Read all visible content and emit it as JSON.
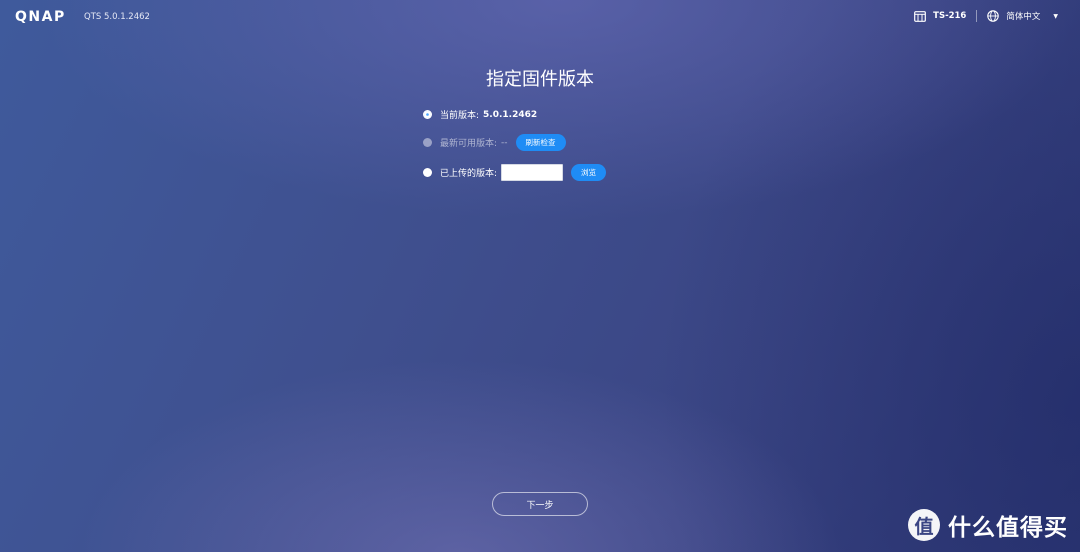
{
  "header": {
    "logo": "QNAP",
    "firmware_label": "QTS 5.0.1.2462",
    "device_name": "TS-216",
    "language": "简体中文"
  },
  "main": {
    "title": "指定固件版本",
    "options": [
      {
        "label": "当前版本:",
        "value": "5.0.1.2462",
        "selected": true,
        "enabled": true
      },
      {
        "label": "最新可用版本:",
        "value": "--",
        "button": "刷新检查",
        "selected": false,
        "enabled": false
      },
      {
        "label": "已上传的版本:",
        "input_value": "",
        "button": "浏览",
        "selected": false,
        "enabled": true
      }
    ],
    "next_button": "下一步"
  },
  "watermark": {
    "logo_char": "值",
    "text": "什么值得买"
  },
  "colors": {
    "accent": "#1f8cf5",
    "background": "#3f4f8e"
  }
}
